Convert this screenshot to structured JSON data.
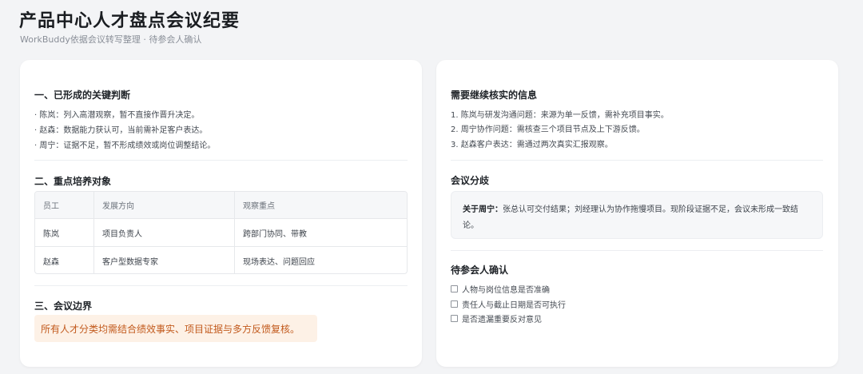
{
  "page": {
    "title": "产品中心人才盘点会议纪要",
    "subtitle": "WorkBuddy依据会议转写整理 · 待参会人确认"
  },
  "left": {
    "section1": {
      "title": "一、已形成的关键判断",
      "items": [
        "· 陈岚：列入高潜观察，暂不直接作晋升决定。",
        "· 赵森：数据能力获认可，当前需补足客户表达。",
        "· 周宁：证据不足，暂不形成绩效或岗位调整结论。"
      ]
    },
    "section2": {
      "title": "二、重点培养对象",
      "table": {
        "headers": [
          "员工",
          "发展方向",
          "观察重点"
        ],
        "rows": [
          [
            "陈岚",
            "项目负责人",
            "跨部门协同、带教"
          ],
          [
            "赵森",
            "客户型数据专家",
            "现场表达、问题回应"
          ]
        ]
      }
    },
    "section3": {
      "title": "三、会议边界",
      "note": "所有人才分类均需结合绩效事实、项目证据与多方反馈复核。"
    }
  },
  "right": {
    "verify": {
      "title": "需要继续核实的信息",
      "items": [
        "1. 陈岚与研发沟通问题：来源为单一反馈，需补充项目事实。",
        "2. 周宁协作问题：需核查三个项目节点及上下游反馈。",
        "3. 赵森客户表达：需通过两次真实汇报观察。"
      ]
    },
    "dispute": {
      "title": "会议分歧",
      "label": "关于周宁：",
      "text": "张总认可交付结果；刘经理认为协作拖慢项目。现阶段证据不足，会议未形成一致结论。"
    },
    "confirm": {
      "title": "待参会人确认",
      "items": [
        "人物与岗位信息是否准确",
        "责任人与截止日期是否可执行",
        "是否遗漏重要反对意见"
      ]
    }
  }
}
